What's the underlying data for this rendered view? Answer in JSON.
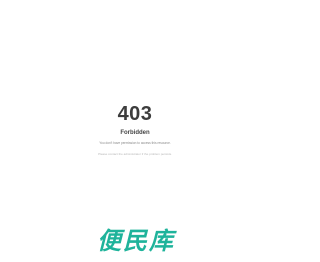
{
  "error": {
    "code": "403",
    "title": "Forbidden",
    "message": "You don't have permission to access this resource.",
    "contact": "Please contact the administrator if the problem persists."
  },
  "logo": {
    "text": "便民库",
    "color": "#1fb39b"
  }
}
